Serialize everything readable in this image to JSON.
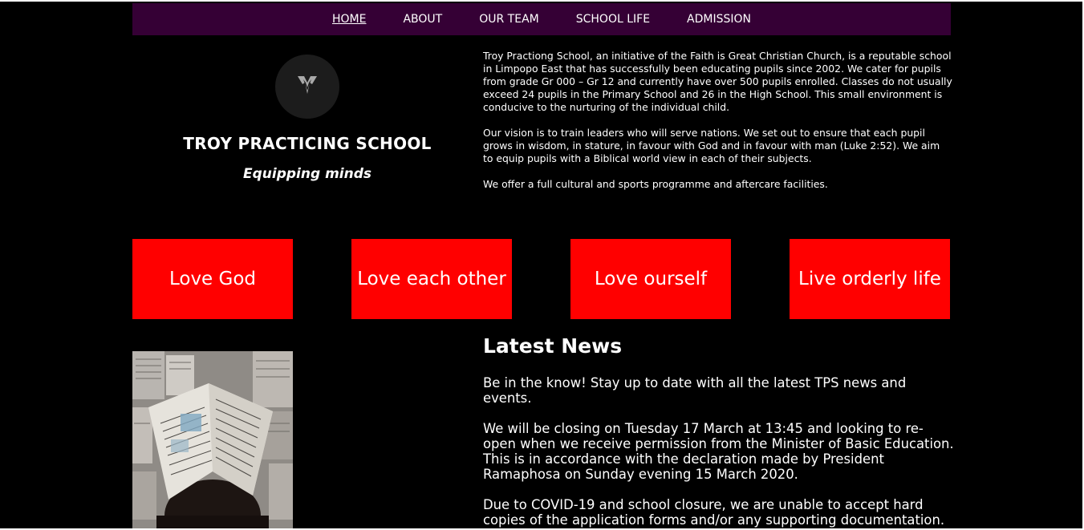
{
  "nav": {
    "items": [
      "HOME",
      "ABOUT",
      "OUR TEAM",
      "SCHOOL LIFE",
      "ADMISSION"
    ],
    "active": "HOME"
  },
  "header": {
    "logo_icon": "school-logo-icon",
    "school_name": "TROY PRACTICING SCHOOL",
    "motto": "Equipping minds"
  },
  "intro": {
    "paragraphs": [
      "Troy Practiong School, an initiative of the Faith is Great Christian Church, is a reputable school in Limpopo East that has successfully been educating pupils since 2002. We cater for pupils from grade Gr 000 – Gr 12 and currently have over 500 pupils enrolled. Classes do not usually exceed 24 pupils in the Primary School and 26 in the High School. This small environment is conducive to the nurturing of the individual child.",
      "Our vision is to train leaders who will serve nations. We set out to ensure that each pupil grows in wisdom, in stature, in favour with God and in favour with man (Luke 2:52). We aim to equip pupils with a Biblical world view in each of their subjects.",
      "We offer a full cultural and sports programme and aftercare facilities."
    ]
  },
  "values": [
    "Love God",
    "Love each other",
    "Love ourself",
    "Live orderly life"
  ],
  "news": {
    "title": "Latest News",
    "paragraphs": [
      "Be in the know! Stay up to date with all the latest TPS news and events.",
      "We will be closing on Tuesday 17 March at 13:45 and looking to re-open when we receive permission from the Minister of Basic Education. This is in accordance with the declaration made by President Ramaphosa on Sunday evening 15 March 2020.",
      "Due to COVID-19 and school closure, we are unable to accept hard copies of the application forms and/or any supporting documentation."
    ]
  },
  "colors": {
    "nav_bg": "#350035",
    "accent_red": "#ff0000",
    "background": "#000000",
    "text": "#ffffff"
  }
}
